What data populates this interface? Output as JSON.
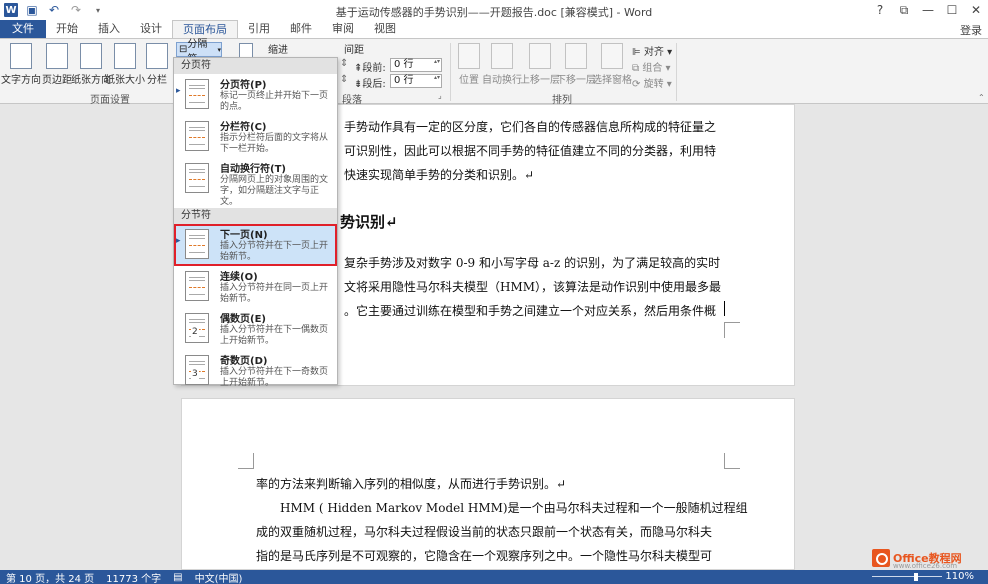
{
  "window": {
    "title": "基于运动传感器的手势识别——开题报告.doc [兼容模式] - Word",
    "app_icon_letter": "W",
    "controls": [
      "?",
      "⧉",
      "—",
      "☐",
      "✕"
    ]
  },
  "qat": {
    "save_icon": "save-icon",
    "undo_icon": "undo-icon",
    "redo_icon": "redo-icon"
  },
  "tabs": [
    "文件",
    "开始",
    "插入",
    "设计",
    "页面布局",
    "引用",
    "邮件",
    "审阅",
    "视图"
  ],
  "active_tab": "页面布局",
  "login": "登录",
  "ribbon": {
    "page_setup": {
      "buttons": [
        "文字方向",
        "页边距",
        "纸张方向",
        "纸张大小",
        "分栏"
      ],
      "label": "页面设置"
    },
    "breaks_button": "分隔符",
    "indent_label": "缩进",
    "spacing_label": "间距",
    "before_label": "段前:",
    "before_value": "0 行",
    "after_label": "段后:",
    "after_value": "0 行",
    "paragraph_label": "段落",
    "arrange": {
      "buttons": [
        "位置",
        "自动换行",
        "上移一层",
        "下移一层",
        "选择窗格"
      ],
      "align": [
        "对齐",
        "组合",
        "旋转"
      ],
      "label": "排列"
    }
  },
  "breaks_menu": {
    "page_breaks_header": "分页符",
    "section_breaks_header": "分节符",
    "items": [
      {
        "title": "分页符(P)",
        "desc": "标记一页终止并开始下一页的点。",
        "icon": "page-break-icon"
      },
      {
        "title": "分栏符(C)",
        "desc": "指示分栏符后面的文字将从下一栏开始。",
        "icon": "column-break-icon"
      },
      {
        "title": "自动换行符(T)",
        "desc": "分隔网页上的对象周围的文字，如分隔题注文字与正文。",
        "icon": "text-wrapping-break-icon"
      },
      {
        "title": "下一页(N)",
        "desc": "插入分节符并在下一页上开始新节。",
        "icon": "next-page-section-icon"
      },
      {
        "title": "连续(O)",
        "desc": "插入分节符并在同一页上开始新节。",
        "icon": "continuous-section-icon"
      },
      {
        "title": "偶数页(E)",
        "desc": "插入分节符并在下一偶数页上开始新节。",
        "icon": "even-page-section-icon",
        "badge": "2"
      },
      {
        "title": "奇数页(D)",
        "desc": "插入分节符并在下一奇数页上开始新节。",
        "icon": "odd-page-section-icon",
        "badge": "3"
      }
    ],
    "highlighted": "下一页(N)"
  },
  "document": {
    "page1_lines": [
      "手势动作具有一定的区分度，它们各自的传感器信息所构成的特征量之",
      "可识别性，因此可以根据不同手势的特征值建立不同的分类器，利用特",
      "快速实现简单手势的分类和识别。↵",
      "势识别↵",
      "复杂手势涉及对数字 0-9 和小写字母 a-z 的识别，为了满足较高的实时",
      "文将采用隐性马尔科夫模型（HMM），该算法是动作识别中使用最多最",
      "。它主要通过训练在模型和手势之间建立一个对应关系，然后用条件概"
    ],
    "page2_lines": [
      "率的方法来判断输入序列的相似度，从而进行手势识别。↵",
      "HMM ( Hidden Markov Model HMM)是一个由马尔科夫过程和一个一般随机过程组",
      "成的双重随机过程，马尔科夫过程假设当前的状态只跟前一个状态有关，而隐马尔科夫",
      "指的是马氏序列是不可观察的，它隐含在一个观察序列之中。一个隐性马尔科夫模型可"
    ]
  },
  "status": {
    "page": "第 10 页，共 24 页",
    "words": "11773 个字",
    "language": "中文(中国)",
    "zoom": "110%"
  },
  "watermark": {
    "brand": "Office教程网",
    "url": "www.office26.com"
  }
}
